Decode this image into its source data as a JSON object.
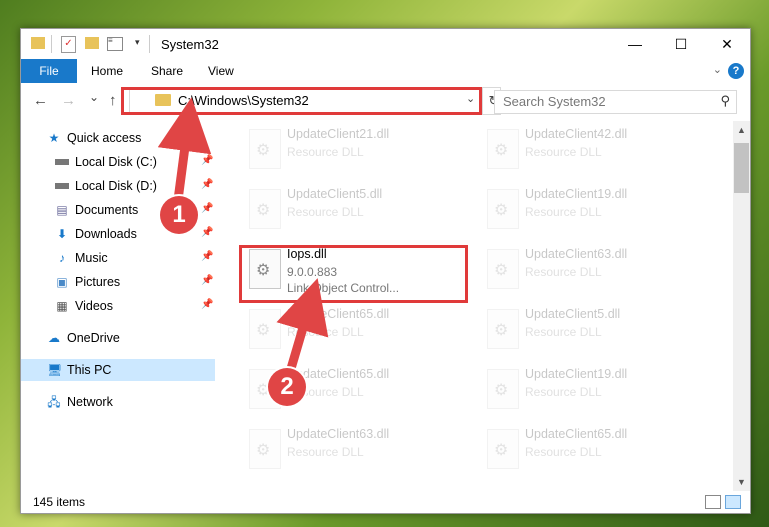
{
  "window": {
    "title": "System32",
    "minimize": "—",
    "maximize": "☐",
    "close": "✕"
  },
  "ribbon": {
    "file": "File",
    "home": "Home",
    "share": "Share",
    "view": "View",
    "help": "?"
  },
  "nav": {
    "back": "←",
    "forward": "→",
    "recent": "⌄",
    "up": "↑",
    "address": "C:\\Windows\\System32",
    "search_placeholder": "Search System32"
  },
  "sidebar": {
    "items": [
      {
        "label": "Quick access",
        "icon": "star-icon",
        "pinned": false
      },
      {
        "label": "Local Disk (C:)",
        "icon": "drive-icon",
        "pinned": true
      },
      {
        "label": "Local Disk (D:)",
        "icon": "drive-icon",
        "pinned": true
      },
      {
        "label": "Documents",
        "icon": "documents-icon",
        "pinned": true
      },
      {
        "label": "Downloads",
        "icon": "download-icon",
        "pinned": true
      },
      {
        "label": "Music",
        "icon": "music-icon",
        "pinned": true
      },
      {
        "label": "Pictures",
        "icon": "pictures-icon",
        "pinned": true
      },
      {
        "label": "Videos",
        "icon": "videos-icon",
        "pinned": true
      },
      {
        "label": "OneDrive",
        "icon": "cloud-icon",
        "pinned": false
      },
      {
        "label": "This PC",
        "icon": "computer-icon",
        "pinned": false,
        "selected": true
      },
      {
        "label": "Network",
        "icon": "network-icon",
        "pinned": false
      }
    ]
  },
  "files": [
    {
      "name": "UpdateClient21.dll",
      "sub": "Resource DLL"
    },
    {
      "name": "UpdateClient42.dll",
      "sub": "Resource DLL"
    },
    {
      "name": "UpdateClient5.dll",
      "sub": "Resource DLL"
    },
    {
      "name": "UpdateClient19.dll",
      "sub": "Resource DLL"
    },
    {
      "name": "Iops.dll",
      "sub": "9.0.0.883",
      "sub2": "Link Object Control...",
      "highlight": true
    },
    {
      "name": "UpdateClient63.dll",
      "sub": "Resource DLL"
    },
    {
      "name": "UpdateClient65.dll",
      "sub": "Resource DLL"
    },
    {
      "name": "UpdateClient5.dll",
      "sub": "Resource DLL"
    },
    {
      "name": "UpdateClient65.dll",
      "sub": "Resource DLL"
    },
    {
      "name": "UpdateClient19.dll",
      "sub": "Resource DLL"
    },
    {
      "name": "UpdateClient63.dll",
      "sub": "Resource DLL"
    },
    {
      "name": "UpdateClient65.dll",
      "sub": "Resource DLL"
    }
  ],
  "status": {
    "count": "145 items"
  },
  "callouts": [
    "1",
    "2"
  ],
  "colors": {
    "accent": "#1979ca",
    "highlight": "#e03a3a",
    "selection": "#cce8ff"
  }
}
